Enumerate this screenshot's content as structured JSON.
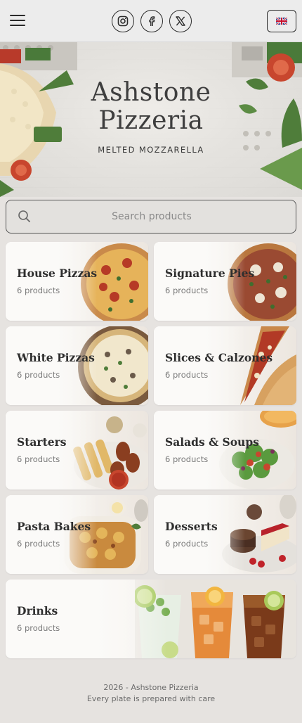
{
  "header": {
    "menu_icon": "hamburger-menu-icon",
    "socials": [
      {
        "name": "instagram",
        "icon": "instagram-icon"
      },
      {
        "name": "facebook",
        "icon": "facebook-icon"
      },
      {
        "name": "x",
        "icon": "x-icon"
      }
    ],
    "language_icon": "uk-flag-icon"
  },
  "hero": {
    "title_line1": "Ashstone",
    "title_line2": "Pizzeria",
    "subtitle": "MELTED MOZZARELLA"
  },
  "search": {
    "placeholder": "Search products",
    "value": ""
  },
  "categories": [
    {
      "title": "House Pizzas",
      "count": "6 products"
    },
    {
      "title": "Signature Pies",
      "count": "6 products"
    },
    {
      "title": "White Pizzas",
      "count": "6 products"
    },
    {
      "title": "Slices & Calzones",
      "count": "6 products"
    },
    {
      "title": "Starters",
      "count": "6 products"
    },
    {
      "title": "Salads & Soups",
      "count": "6 products"
    },
    {
      "title": "Pasta Bakes",
      "count": "6 products"
    },
    {
      "title": "Desserts",
      "count": "6 products"
    },
    {
      "title": "Drinks",
      "count": "6 products"
    }
  ],
  "footer": {
    "line1": "2026 - Ashstone Pizzeria",
    "line2": "Every plate is prepared with care"
  },
  "colors": {
    "background": "#e6e3e0",
    "header": "#ececec",
    "text_dark": "#2e2e2e",
    "pizza_red": "#c8462e",
    "basil_green": "#4f7d3a"
  }
}
